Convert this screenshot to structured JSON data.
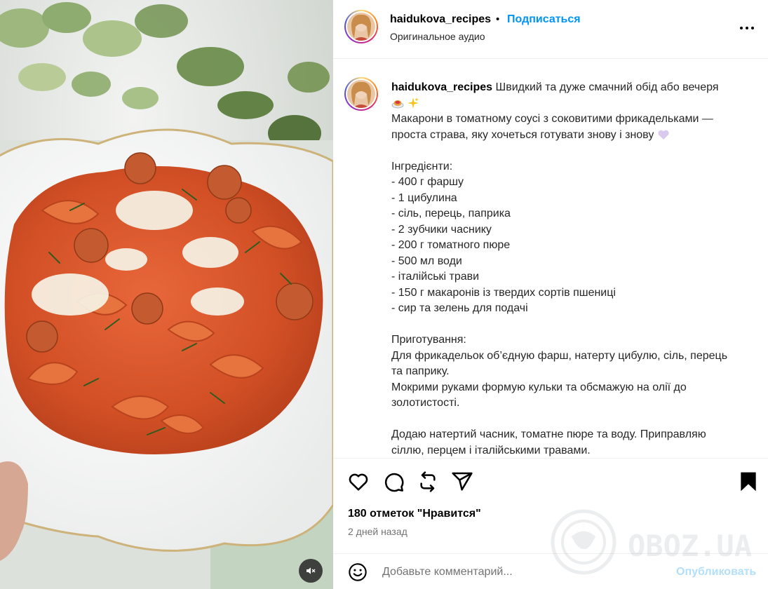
{
  "post": {
    "username": "haidukova_recipes",
    "separator": "•",
    "follow_label": "Подписаться",
    "audio_label": "Оригинальное аудио",
    "more_icon": "more-horizontal-icon"
  },
  "caption": {
    "username": "haidukova_recipes",
    "first_line": " Швидкий та дуже смачний обід або вечеря",
    "emojis": [
      "spaghetti-emoji",
      "sparkles-emoji"
    ],
    "lines": [
      "Макарони в томатному соусі з соковитими фрикадельками —",
      "проста страва, яку хочеться готувати знову і знову"
    ],
    "heart_emoji": "light-purple-heart-emoji",
    "ingredients_title": "Інгредієнти:",
    "ingredients": [
      "- 400 г фаршу",
      "- 1 цибулина",
      "- сіль, перець, паприка",
      "- 2 зубчики часнику",
      "- 200 г томатного пюре",
      "- 500 мл води",
      "- італійські трави",
      "- 150 г макаронів із твердих сортів пшениці",
      "- сир та зелень для подачі"
    ],
    "method_title": "Приготування:",
    "method_paragraph_1": [
      "Для фрикадельок об’єдную фарш, натерту цибулю, сіль, перець",
      "та паприку.",
      "Мокрими руками формую кульки та обсмажую на олії до",
      "золотистості."
    ],
    "method_paragraph_2": [
      "Додаю натертий часник, томатне пюре та воду. Приправляю",
      "сіллю, перцем і італійськими травами."
    ]
  },
  "actions": {
    "icons": [
      "heart-icon",
      "comment-icon",
      "repost-icon",
      "share-icon",
      "save-icon"
    ],
    "likes_text": "180 отметок \"Нравится\"",
    "time_text": "2 дней назад"
  },
  "comment": {
    "placeholder": "Добавьте комментарий...",
    "post_label": "Опубликовать",
    "post_color": "#b2dffc"
  },
  "watermark": {
    "text": "OBOZ.UA"
  },
  "colors": {
    "accent": "#0095f6",
    "text_primary": "#000000",
    "text_secondary": "#737373",
    "sauce": "#d9542b",
    "plate": "#ffffff"
  }
}
